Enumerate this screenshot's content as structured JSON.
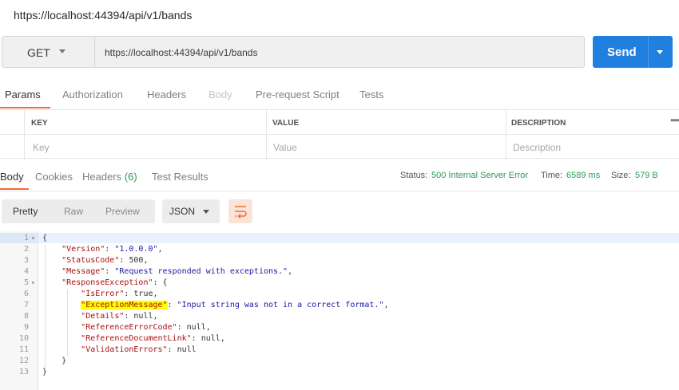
{
  "title": "https://localhost:44394/api/v1/bands",
  "request": {
    "method": "GET",
    "url": "https://localhost:44394/api/v1/bands",
    "send_label": "Send"
  },
  "request_tabs": [
    {
      "label": "Params",
      "state": "active"
    },
    {
      "label": "Authorization",
      "state": "normal"
    },
    {
      "label": "Headers",
      "state": "normal"
    },
    {
      "label": "Body",
      "state": "disabled"
    },
    {
      "label": "Pre-request Script",
      "state": "normal"
    },
    {
      "label": "Tests",
      "state": "normal"
    }
  ],
  "params": {
    "headers": [
      "KEY",
      "VALUE",
      "DESCRIPTION"
    ],
    "placeholders": [
      "Key",
      "Value",
      "Description"
    ],
    "more_icon": "more-icon"
  },
  "response_tabs": {
    "body": "Body",
    "cookies": "Cookies",
    "headers": "Headers",
    "headers_count": "(6)",
    "test_results": "Test Results"
  },
  "status": {
    "status_label": "Status:",
    "status_value": "500 Internal Server Error",
    "time_label": "Time:",
    "time_value": "6589 ms",
    "size_label": "Size:",
    "size_value": "579 B"
  },
  "format": {
    "pretty": "Pretty",
    "raw": "Raw",
    "preview": "Preview",
    "json": "JSON",
    "wrap_icon": "wrap-lines-icon"
  },
  "colors": {
    "accent": "#f26b3a",
    "send": "#1f80e0",
    "status_ok": "#2c9a58",
    "highlight": "#ffff00"
  },
  "code": {
    "line_numbers": [
      "1",
      "2",
      "3",
      "4",
      "5",
      "6",
      "7",
      "8",
      "9",
      "10",
      "11",
      "12",
      "13"
    ],
    "open_brace": "{",
    "close_brace": "}",
    "version_key": "\"Version\"",
    "version_val": "\"1.0.0.0\"",
    "statuscode_key": "\"StatusCode\"",
    "statuscode_val": "500",
    "message_key": "\"Message\"",
    "message_val": "\"Request responded with exceptions.\"",
    "respexc_key": "\"ResponseException\"",
    "iserror_key": "\"IsError\"",
    "iserror_val": "true",
    "excmsg_key": "\"ExceptionMessage\"",
    "excmsg_val": "\"Input string was not in a correct format.\"",
    "details_key": "\"Details\"",
    "details_val": "null",
    "referr_key": "\"ReferenceErrorCode\"",
    "referr_val": "null",
    "refdoc_key": "\"ReferenceDocumentLink\"",
    "refdoc_val": "null",
    "validation_key": "\"ValidationErrors\"",
    "validation_val": "null",
    "inner_close": "}",
    "outer_close": "}"
  }
}
